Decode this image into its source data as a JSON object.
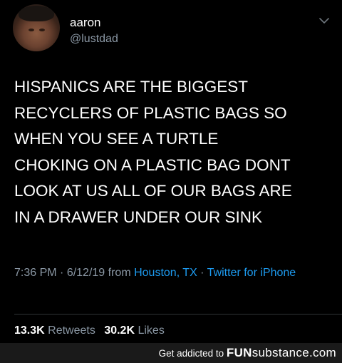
{
  "user": {
    "display_name": "aaron",
    "handle": "@lustdad"
  },
  "tweet": {
    "lines": [
      "HISPANICS ARE THE BIGGEST",
      "RECYCLERS OF PLASTIC BAGS SO",
      "WHEN YOU SEE A TURTLE",
      "CHOKING ON A PLASTIC BAG DONT",
      "LOOK AT US ALL OF OUR BAGS ARE",
      "IN A DRAWER UNDER OUR SINK"
    ]
  },
  "meta": {
    "time": "7:36 PM",
    "separator1": " · ",
    "date": "6/12/19",
    "from_label": " from ",
    "location": "Houston, TX",
    "separator2": " · ",
    "client": "Twitter for iPhone"
  },
  "stats": {
    "retweets_count": "13.3K",
    "retweets_label": "Retweets",
    "likes_count": "30.2K",
    "likes_label": "Likes"
  },
  "footer": {
    "tagline": "Get addicted to ",
    "brand_fun": "FUN",
    "brand_substance": "substance",
    "brand_com": ".com"
  },
  "colors": {
    "background": "#000000",
    "text": "#ffffff",
    "secondary": "#8b98a5",
    "link": "#1d9bf0",
    "footer_bg": "#1a1a1a"
  },
  "icons": {
    "avatar": "profile-photo",
    "menu": "chevron-down-icon"
  }
}
